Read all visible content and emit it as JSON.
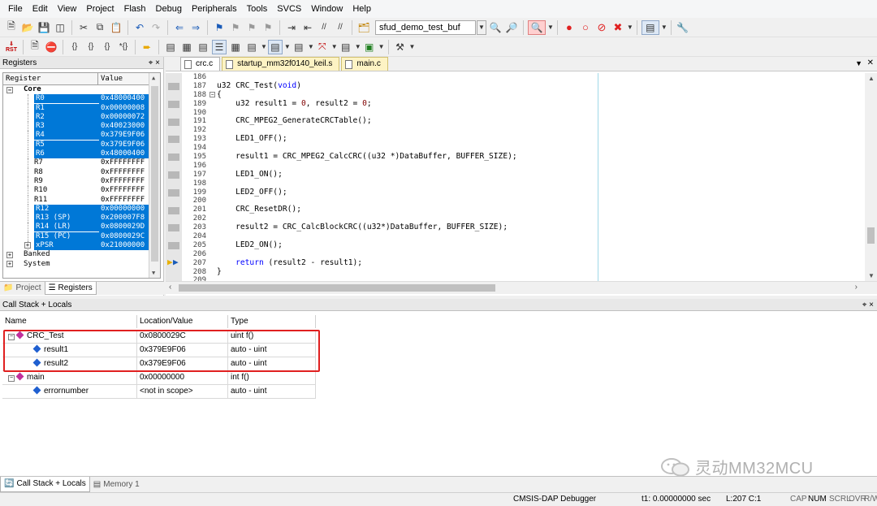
{
  "menu": [
    "File",
    "Edit",
    "View",
    "Project",
    "Flash",
    "Debug",
    "Peripherals",
    "Tools",
    "SVCS",
    "Window",
    "Help"
  ],
  "toolbar": {
    "target_combo": "sfud_demo_test_buf",
    "rst_label": "RST"
  },
  "registers_panel": {
    "title": "Registers",
    "pin": "⌖ ×",
    "col_register": "Register",
    "col_value": "Value",
    "core_label": "Core",
    "registers": [
      {
        "name": "R0",
        "value": "0x48000400",
        "selected": true
      },
      {
        "name": "R1",
        "value": "0x00000008",
        "selected": true
      },
      {
        "name": "R2",
        "value": "0x00000072",
        "selected": true
      },
      {
        "name": "R3",
        "value": "0x40023000",
        "selected": true
      },
      {
        "name": "R4",
        "value": "0x379E9F06",
        "selected": true
      },
      {
        "name": "R5",
        "value": "0x379E9F06",
        "selected": true
      },
      {
        "name": "R6",
        "value": "0x48000400",
        "selected": true
      },
      {
        "name": "R7",
        "value": "0xFFFFFFFF",
        "selected": false
      },
      {
        "name": "R8",
        "value": "0xFFFFFFFF",
        "selected": false
      },
      {
        "name": "R9",
        "value": "0xFFFFFFFF",
        "selected": false
      },
      {
        "name": "R10",
        "value": "0xFFFFFFFF",
        "selected": false
      },
      {
        "name": "R11",
        "value": "0xFFFFFFFF",
        "selected": false
      },
      {
        "name": "R12",
        "value": "0x00000000",
        "selected": true
      },
      {
        "name": "R13 (SP)",
        "value": "0x200007F8",
        "selected": true
      },
      {
        "name": "R14 (LR)",
        "value": "0x0800029D",
        "selected": true
      },
      {
        "name": "R15 (PC)",
        "value": "0x0800029C",
        "selected": true
      },
      {
        "name": "xPSR",
        "value": "0x21000000",
        "selected": true
      }
    ],
    "banked_label": "Banked",
    "system_label": "System",
    "tab_project": "Project",
    "tab_registers": "Registers"
  },
  "editor": {
    "tabs": [
      {
        "label": "crc.c",
        "active": true
      },
      {
        "label": "startup_mm32f0140_keil.s",
        "active": false
      },
      {
        "label": "main.c",
        "active": false
      }
    ],
    "lines": [
      {
        "n": "186",
        "t": ""
      },
      {
        "n": "187",
        "t": "u32 CRC_Test(void)"
      },
      {
        "n": "188",
        "t": "{"
      },
      {
        "n": "189",
        "t": "    u32 result1 = 0, result2 = 0;"
      },
      {
        "n": "190",
        "t": ""
      },
      {
        "n": "191",
        "t": "    CRC_MPEG2_GenerateCRCTable();"
      },
      {
        "n": "192",
        "t": ""
      },
      {
        "n": "193",
        "t": "    LED1_OFF();"
      },
      {
        "n": "194",
        "t": ""
      },
      {
        "n": "195",
        "t": "    result1 = CRC_MPEG2_CalcCRC((u32 *)DataBuffer, BUFFER_SIZE);"
      },
      {
        "n": "196",
        "t": ""
      },
      {
        "n": "197",
        "t": "    LED1_ON();"
      },
      {
        "n": "198",
        "t": ""
      },
      {
        "n": "199",
        "t": "    LED2_OFF();"
      },
      {
        "n": "200",
        "t": ""
      },
      {
        "n": "201",
        "t": "    CRC_ResetDR();"
      },
      {
        "n": "202",
        "t": ""
      },
      {
        "n": "203",
        "t": "    result2 = CRC_CalcBlockCRC((u32*)DataBuffer, BUFFER_SIZE);"
      },
      {
        "n": "204",
        "t": ""
      },
      {
        "n": "205",
        "t": "    LED2_ON();"
      },
      {
        "n": "206",
        "t": ""
      },
      {
        "n": "207",
        "t": "    return (result2 - result1);"
      },
      {
        "n": "208",
        "t": "}"
      },
      {
        "n": "209",
        "t": ""
      }
    ]
  },
  "callstack": {
    "title": "Call Stack + Locals",
    "pin": "⌖ ×",
    "col_name": "Name",
    "col_location": "Location/Value",
    "col_type": "Type",
    "rows": [
      {
        "name": "CRC_Test",
        "location": "0x0800029C",
        "type": "uint f()",
        "kind": "func",
        "level": 0,
        "expander": "−"
      },
      {
        "name": "result1",
        "location": "0x379E9F06",
        "type": "auto - uint",
        "kind": "var",
        "level": 1,
        "expander": ""
      },
      {
        "name": "result2",
        "location": "0x379E9F06",
        "type": "auto - uint",
        "kind": "var",
        "level": 1,
        "expander": ""
      },
      {
        "name": "main",
        "location": "0x00000000",
        "type": "int f()",
        "kind": "func",
        "level": 0,
        "expander": "−"
      },
      {
        "name": "errornumber",
        "location": "<not in scope>",
        "type": "auto - uint",
        "kind": "var",
        "level": 1,
        "expander": ""
      }
    ],
    "tab_callstack": "Call Stack + Locals",
    "tab_memory": "Memory 1"
  },
  "statusbar": {
    "debugger": "CMSIS-DAP Debugger",
    "time": "t1: 0.00000000 sec",
    "position": "L:207 C:1",
    "cap": "CAP",
    "num": "NUM",
    "scrl": "SCRL",
    "ovr": "OVR",
    "rw": "R/W"
  },
  "watermark": "灵动MM32MCU",
  "colors": {
    "selection": "#0078d7",
    "keyword": "#0000ff",
    "number": "#800000",
    "highlight_box": "#e02020"
  }
}
